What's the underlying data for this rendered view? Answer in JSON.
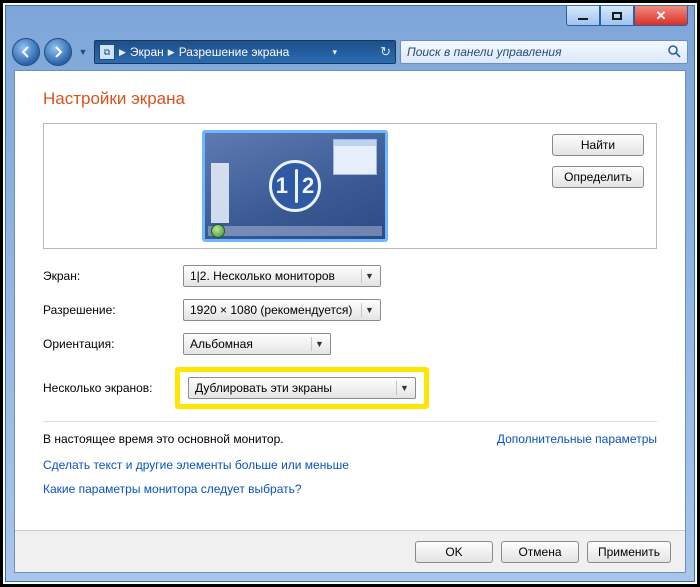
{
  "breadcrumb": {
    "item1": "Экран",
    "item2": "Разрешение экрана"
  },
  "search": {
    "placeholder": "Поиск в панели управления"
  },
  "title": "Настройки экрана",
  "preview": {
    "circle_left": "1",
    "circle_right": "2"
  },
  "buttons": {
    "find": "Найти",
    "detect": "Определить",
    "ok": "OK",
    "cancel": "Отмена",
    "apply": "Применить"
  },
  "labels": {
    "screen": "Экран:",
    "resolution": "Разрешение:",
    "orientation": "Ориентация:",
    "multi": "Несколько экранов:"
  },
  "values": {
    "screen": "1|2. Несколько мониторов",
    "resolution": "1920 × 1080 (рекомендуется)",
    "orientation": "Альбомная",
    "multi": "Дублировать эти экраны"
  },
  "status": "В настоящее время это основной монитор.",
  "links": {
    "advanced": "Дополнительные параметры",
    "dpi": "Сделать текст и другие элементы больше или меньше",
    "help": "Какие параметры монитора следует выбрать?"
  }
}
